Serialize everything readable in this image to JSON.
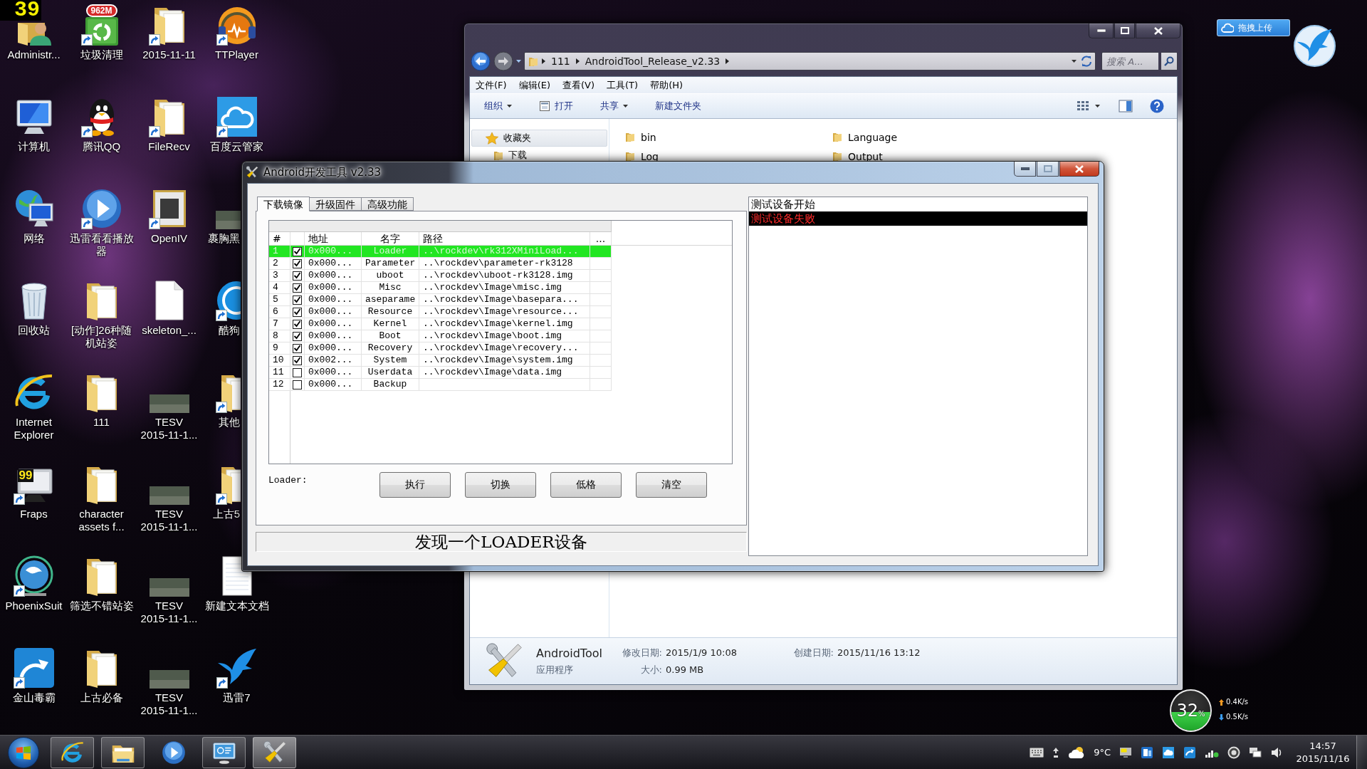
{
  "fps_overlay": "39",
  "desktop_icons": [
    {
      "label": "Administr...",
      "kind": "user-folder",
      "shortcut": false,
      "covered": false
    },
    {
      "label": "垃圾清理",
      "kind": "cleaner",
      "shortcut": true,
      "covered": false,
      "badge": "962M"
    },
    {
      "label": "2015-11-11",
      "kind": "folder",
      "shortcut": true,
      "covered": false
    },
    {
      "label": "TTPlayer",
      "kind": "headphones",
      "shortcut": true,
      "covered": false
    },
    {
      "label": "计算机",
      "kind": "computer",
      "shortcut": false,
      "covered": false
    },
    {
      "label": "腾讯QQ",
      "kind": "penguin",
      "shortcut": true,
      "covered": false
    },
    {
      "label": "FileRecv",
      "kind": "folder",
      "shortcut": true,
      "covered": false
    },
    {
      "label": "百度云管家",
      "kind": "cloud-app",
      "shortcut": true,
      "covered": false
    },
    {
      "label": "网络",
      "kind": "network",
      "shortcut": false,
      "covered": false
    },
    {
      "label": "迅雷看看播放器",
      "kind": "player",
      "shortcut": true,
      "covered": false
    },
    {
      "label": "OpenIV",
      "kind": "openiv",
      "shortcut": true,
      "covered": false
    },
    {
      "label": "裹胸黑",
      "kind": "photo",
      "shortcut": false,
      "covered": true
    },
    {
      "label": "回收站",
      "kind": "recycle-bin",
      "shortcut": false,
      "covered": false
    },
    {
      "label": "[动作]26种随机站姿",
      "kind": "folder",
      "shortcut": false,
      "covered": false
    },
    {
      "label": "skeleton_...",
      "kind": "document",
      "shortcut": false,
      "covered": false
    },
    {
      "label": "酷狗",
      "kind": "disc-app",
      "shortcut": true,
      "covered": true
    },
    {
      "label": "Internet Explorer",
      "kind": "ie",
      "shortcut": false,
      "covered": false
    },
    {
      "label": "111",
      "kind": "folder",
      "shortcut": false,
      "covered": false
    },
    {
      "label": "TESV 2015-11-1...",
      "kind": "photo",
      "shortcut": false,
      "covered": false
    },
    {
      "label": "其他",
      "kind": "folder",
      "shortcut": true,
      "covered": true
    },
    {
      "label": "Fraps",
      "kind": "fraps",
      "shortcut": true,
      "covered": false,
      "badge": "99"
    },
    {
      "label": "character assets f...",
      "kind": "folder",
      "shortcut": false,
      "covered": false
    },
    {
      "label": "TESV 2015-11-1...",
      "kind": "photo",
      "shortcut": false,
      "covered": false
    },
    {
      "label": "上古5",
      "kind": "folder",
      "shortcut": true,
      "covered": true
    },
    {
      "label": "PhoenixSuit",
      "kind": "globe-app",
      "shortcut": true,
      "covered": false
    },
    {
      "label": "筛选不错站姿",
      "kind": "folder",
      "shortcut": false,
      "covered": false
    },
    {
      "label": "TESV 2015-11-1...",
      "kind": "photo",
      "shortcut": false,
      "covered": false
    },
    {
      "label": "新建文本文档",
      "kind": "notepad",
      "shortcut": false,
      "covered": false
    },
    {
      "label": "金山毒霸",
      "kind": "arrow-app",
      "shortcut": true,
      "covered": false
    },
    {
      "label": "上古必备",
      "kind": "folder",
      "shortcut": false,
      "covered": false
    },
    {
      "label": "TESV 2015-11-1...",
      "kind": "photo",
      "shortcut": false,
      "covered": false
    },
    {
      "label": "迅雷7",
      "kind": "bird",
      "shortcut": true,
      "covered": false
    }
  ],
  "explorer": {
    "breadcrumb": [
      "111",
      "AndroidTool_Release_v2.33"
    ],
    "search_placeholder": "搜索 A...",
    "menu": [
      "文件(F)",
      "编辑(E)",
      "查看(V)",
      "工具(T)",
      "帮助(H)"
    ],
    "toolbar": [
      {
        "label": "组织",
        "kind": "menu"
      },
      {
        "label": "打开",
        "kind": "open"
      },
      {
        "label": "共享",
        "kind": "menu"
      },
      {
        "label": "新建文件夹",
        "kind": "plain"
      }
    ],
    "nav": [
      {
        "label": "收藏夹",
        "kind": "favorites",
        "selected": true
      },
      {
        "label": "下载",
        "kind": "folder",
        "selected": false
      }
    ],
    "files": [
      "bin",
      "Language",
      "Log",
      "Output"
    ],
    "details": {
      "name": "AndroidTool",
      "type": "应用程序",
      "fields": [
        {
          "label": "修改日期:",
          "value": "2015/1/9 10:08"
        },
        {
          "label": "创建日期:",
          "value": "2015/11/16 13:12"
        },
        {
          "label": "大小:",
          "value": "0.99 MB"
        }
      ]
    }
  },
  "android_tool": {
    "title": "Android开发工具 v2.33",
    "tabs": [
      {
        "label": "下载镜像",
        "selected": true
      },
      {
        "label": "升级固件",
        "selected": false
      },
      {
        "label": "高级功能",
        "selected": false
      }
    ],
    "columns": [
      "#",
      "地址",
      "名字",
      "路径",
      "..."
    ],
    "rows": [
      {
        "index": "1",
        "checked": true,
        "selected": true,
        "address": "0x000...",
        "name": "Loader",
        "path": "..\\rockdev\\rk312XMiniLoad..."
      },
      {
        "index": "2",
        "checked": true,
        "selected": false,
        "address": "0x000...",
        "name": "Parameter",
        "path": "..\\rockdev\\parameter-rk3128"
      },
      {
        "index": "3",
        "checked": true,
        "selected": false,
        "address": "0x000...",
        "name": "uboot",
        "path": "..\\rockdev\\uboot-rk3128.img"
      },
      {
        "index": "4",
        "checked": true,
        "selected": false,
        "address": "0x000...",
        "name": "Misc",
        "path": "..\\rockdev\\Image\\misc.img"
      },
      {
        "index": "5",
        "checked": true,
        "selected": false,
        "address": "0x000...",
        "name": "aseparame",
        "path": "..\\rockdev\\Image\\basepara..."
      },
      {
        "index": "6",
        "checked": true,
        "selected": false,
        "address": "0x000...",
        "name": "Resource",
        "path": "..\\rockdev\\Image\\resource..."
      },
      {
        "index": "7",
        "checked": true,
        "selected": false,
        "address": "0x000...",
        "name": "Kernel",
        "path": "..\\rockdev\\Image\\kernel.img"
      },
      {
        "index": "8",
        "checked": true,
        "selected": false,
        "address": "0x000...",
        "name": "Boot",
        "path": "..\\rockdev\\Image\\boot.img"
      },
      {
        "index": "9",
        "checked": true,
        "selected": false,
        "address": "0x000...",
        "name": "Recovery",
        "path": "..\\rockdev\\Image\\recovery..."
      },
      {
        "index": "10",
        "checked": true,
        "selected": false,
        "address": "0x002...",
        "name": "System",
        "path": "..\\rockdev\\Image\\system.img"
      },
      {
        "index": "11",
        "checked": false,
        "selected": false,
        "address": "0x000...",
        "name": "Userdata",
        "path": "..\\rockdev\\Image\\data.img"
      },
      {
        "index": "12",
        "checked": false,
        "selected": false,
        "address": "0x000...",
        "name": "Backup"
      }
    ],
    "loader_label": "Loader:",
    "buttons": [
      "执行",
      "切换",
      "低格",
      "清空"
    ],
    "status": "发现一个LOADER设备",
    "log": [
      {
        "text": "测试设备开始",
        "kind": "info",
        "selected": false
      },
      {
        "text": "测试设备失败",
        "kind": "error",
        "selected": true
      }
    ]
  },
  "upload_button": "拖拽上传",
  "memory_ball": {
    "value": "32",
    "unit": "%",
    "level": 0.47,
    "upload": "0.4K/s",
    "download": "0.5K/s"
  },
  "taskbar": {
    "apps": [
      {
        "kind": "ie",
        "running": true,
        "active": false
      },
      {
        "kind": "explorer",
        "running": true,
        "active": false
      },
      {
        "kind": "player",
        "running": false,
        "active": false
      },
      {
        "kind": "remote",
        "running": true,
        "active": false
      },
      {
        "kind": "tools",
        "running": true,
        "active": true
      }
    ],
    "tray": [
      {
        "kind": "keyboard"
      },
      {
        "kind": "ime"
      },
      {
        "kind": "weather"
      },
      {
        "kind": "temperature",
        "text": "9°C"
      },
      {
        "kind": "fraps"
      },
      {
        "kind": "app-blue"
      },
      {
        "kind": "cloud"
      },
      {
        "kind": "swirl"
      },
      {
        "kind": "wifi"
      },
      {
        "kind": "shield"
      },
      {
        "kind": "network"
      },
      {
        "kind": "speaker"
      }
    ],
    "time": "14:57",
    "date": "2015/11/16"
  }
}
